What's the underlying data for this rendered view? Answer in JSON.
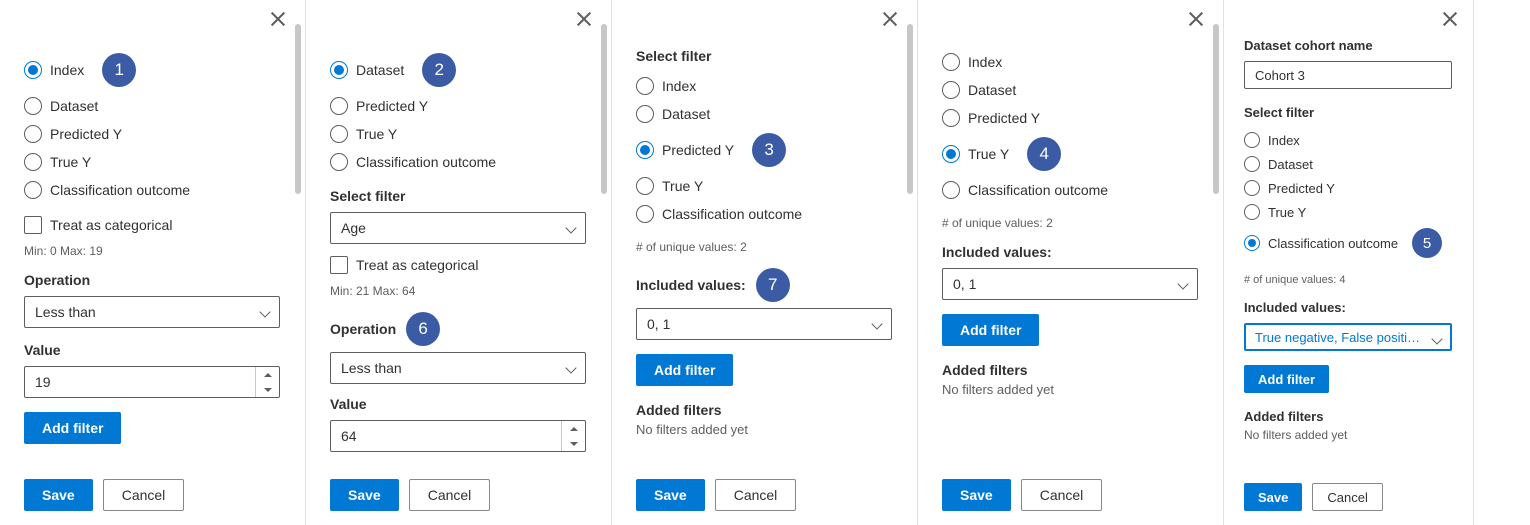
{
  "common": {
    "radio_index": "Index",
    "radio_dataset": "Dataset",
    "radio_predy": "Predicted Y",
    "radio_truey": "True Y",
    "radio_classout": "Classification outcome",
    "treat_categorical": "Treat as categorical",
    "operation_label": "Operation",
    "value_label": "Value",
    "select_filter_label": "Select filter",
    "included_values_label": "Included values:",
    "add_filter": "Add filter",
    "added_filters_title": "Added filters",
    "added_filters_empty": "No filters added yet",
    "save": "Save",
    "cancel": "Cancel"
  },
  "panel1": {
    "selected": "Index",
    "minmax": "Min: 0 Max: 19",
    "operation": "Less than",
    "value": "19"
  },
  "panel2": {
    "selected": "Dataset",
    "dataset_feature": "Age",
    "minmax": "Min: 21 Max: 64",
    "operation": "Less than",
    "value": "64"
  },
  "panel3": {
    "selected": "Predicted Y",
    "unique_hint": "# of unique values: 2",
    "included": "0, 1"
  },
  "panel4": {
    "selected": "True Y",
    "unique_hint": "# of unique values: 2",
    "included": "0, 1"
  },
  "panel5": {
    "cohort_name_label": "Dataset cohort name",
    "cohort_name_value": "Cohort 3",
    "selected": "Classification outcome",
    "unique_hint": "# of unique values: 4",
    "included": "True negative, False positive, False neg…"
  },
  "badges": {
    "b1": "1",
    "b2": "2",
    "b3": "3",
    "b4": "4",
    "b5": "5",
    "b6": "6",
    "b7": "7"
  }
}
